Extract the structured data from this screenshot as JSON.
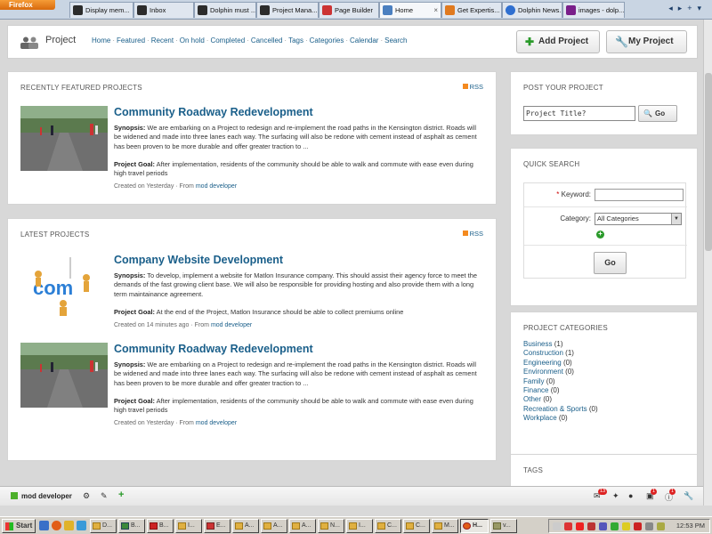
{
  "browser": {
    "menu_button": "Firefox",
    "tabs": [
      {
        "label": "Display mem..."
      },
      {
        "label": "Inbox"
      },
      {
        "label": "Dolphin must ..."
      },
      {
        "label": "Project Mana..."
      },
      {
        "label": "Page Builder"
      },
      {
        "label": "Home"
      },
      {
        "label": "Get Expertis..."
      },
      {
        "label": "Dolphin News..."
      },
      {
        "label": "images - dolp..."
      }
    ]
  },
  "header": {
    "title": "Project",
    "nav": [
      "Home",
      "Featured",
      "Recent",
      "On hold",
      "Completed",
      "Cancelled",
      "Tags",
      "Categories",
      "Calendar",
      "Search"
    ],
    "add_button": "Add Project",
    "my_button": "My Project"
  },
  "featured": {
    "title": "RECENTLY FEATURED PROJECTS",
    "rss": "RSS",
    "items": [
      {
        "title": "Community Roadway Redevelopment",
        "synopsis_label": "Synopsis:",
        "synopsis": "We are embarking on a Project to redesign and re-implement the road paths in the Kensington district. Roads will be widened and made into three lanes each way. The surfacing will also be redone with cement instead of asphalt as cement has been proven to be more durable and offer greater traction to ...",
        "goal_label": "Project Goal:",
        "goal": "After implementation, residents of the community should be able to walk and commute with ease even during high travel periods",
        "created": "Created on Yesterday · From",
        "author": "mod developer"
      }
    ]
  },
  "latest": {
    "title": "LATEST PROJECTS",
    "rss": "RSS",
    "items": [
      {
        "title": "Company Website Development",
        "synopsis_label": "Synopsis:",
        "synopsis": "To develop, implement a website for Matlon Insurance company. This should assist their agency force to meet the demands of the fast growing client base. We will also be responsible for providing hosting and also provide them with a long term maintainance agreement.",
        "goal_label": "Project Goal:",
        "goal": "At the end of the Project, Matlon Insurance should be able to collect premiums online",
        "created": "Created on 14 minutes ago · From",
        "author": "mod developer"
      },
      {
        "title": "Community Roadway Redevelopment",
        "synopsis_label": "Synopsis:",
        "synopsis": "We are embarking on a Project to redesign and re-implement the road paths in the Kensington district. Roads will be widened and made into three lanes each way. The surfacing will also be redone with cement instead of asphalt as cement has been proven to be more durable and offer greater traction to ...",
        "goal_label": "Project Goal:",
        "goal": "After implementation, residents of the community should be able to walk and commute with ease even during high travel periods",
        "created": "Created on Yesterday · From",
        "author": "mod developer"
      }
    ]
  },
  "post": {
    "title": "POST YOUR PROJECT",
    "input_value": "Project Title?",
    "go": "Go"
  },
  "quick_search": {
    "title": "QUICK SEARCH",
    "keyword_label": "Keyword:",
    "category_label": "Category:",
    "category_value": "All Categories",
    "go": "Go"
  },
  "categories": {
    "title": "PROJECT CATEGORIES",
    "items": [
      {
        "name": "Business",
        "count": "(1)"
      },
      {
        "name": "Construction",
        "count": "(1)"
      },
      {
        "name": "Engineering",
        "count": "(0)"
      },
      {
        "name": "Environment",
        "count": "(0)"
      },
      {
        "name": "Family",
        "count": "(0)"
      },
      {
        "name": "Finance",
        "count": "(0)"
      },
      {
        "name": "Other",
        "count": "(0)"
      },
      {
        "name": "Recreation & Sports",
        "count": "(0)"
      },
      {
        "name": "Workplace",
        "count": "(0)"
      }
    ]
  },
  "tags": {
    "title": "TAGS"
  },
  "toolbar": {
    "user": "mod developer",
    "badge_mail": "13",
    "badge_cart": "1",
    "badge_info": "1"
  },
  "taskbar": {
    "start": "Start",
    "buttons": [
      "D...",
      "B...",
      "B...",
      "I...",
      "E...",
      "A...",
      "A...",
      "A...",
      "N...",
      "I...",
      "C...",
      "C...",
      "M...",
      "H...",
      "v..."
    ],
    "clock": "12:53 PM"
  },
  "colors": {
    "link": "#1a5f8a",
    "accent_green": "#2a9a2a",
    "badge_red": "#d22222"
  }
}
